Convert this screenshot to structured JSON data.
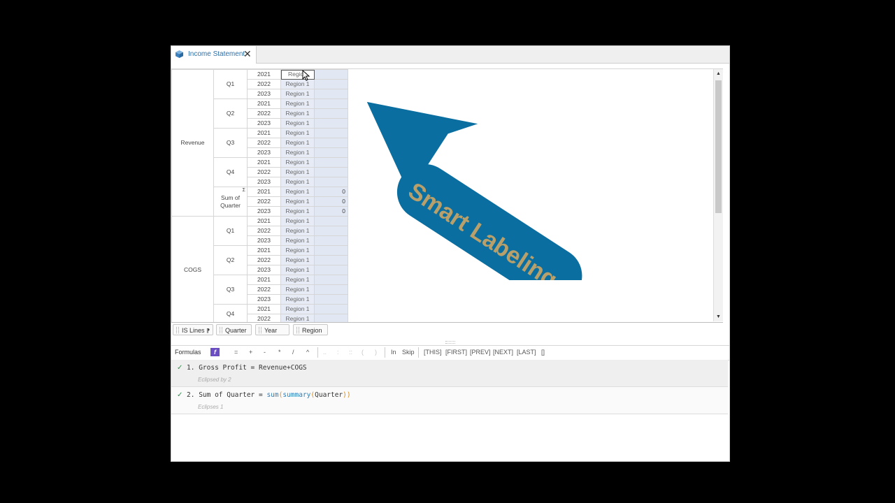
{
  "tab": {
    "title": "Income Statement",
    "close": "✕",
    "icon": "cube-icon"
  },
  "grid": {
    "row1_label": "Revenue",
    "row2_label": "COGS",
    "quarters": [
      "Q1",
      "Q2",
      "Q3",
      "Q4"
    ],
    "sum_label_1": "Sum of",
    "sum_label_2": "Quarter",
    "sum_marker": "Σ",
    "years": [
      "2021",
      "2022",
      "2023"
    ],
    "region": "Region 1",
    "region_selected": "Region",
    "zero": "0"
  },
  "pills": {
    "is_lines": "IS Lines",
    "is_lines_icon": "⁋",
    "quarter": "Quarter",
    "year": "Year",
    "region": "Region"
  },
  "formula_bar": {
    "label": "Formulas",
    "fx": "f",
    "ops": [
      "=",
      "+",
      "-",
      "*",
      "/",
      "^"
    ],
    "dim_ops": [
      "..",
      ":",
      "::",
      "(",
      ")"
    ],
    "in": "In",
    "skip": "Skip",
    "refs": [
      "[THIS]",
      "[FIRST]",
      "[PREV]",
      "[NEXT]",
      "[LAST]",
      "[]"
    ]
  },
  "formulas": [
    {
      "check": "✓",
      "num": "1.",
      "name": "Gross Profit",
      "eq": " = ",
      "expr": "Revenue+COGS",
      "note": "Eclipsed by 2"
    },
    {
      "check": "✓",
      "num": "2.",
      "name": "Sum of Quarter",
      "eq": " = ",
      "fn1": "sum",
      "p1": "(",
      "fn2": "summary",
      "p2": "(",
      "arg": "Quarter",
      "p3": "))",
      "note": "Eclipses 1"
    }
  ],
  "overlay": {
    "text": "Smart Labeling",
    "arrow_color": "#0a6fa0",
    "text_color": "#b9a06a"
  },
  "colors": {
    "selection_fill": "#e6ebf5",
    "accent": "#2f6fa8",
    "fx_button": "#6b4ec2"
  }
}
